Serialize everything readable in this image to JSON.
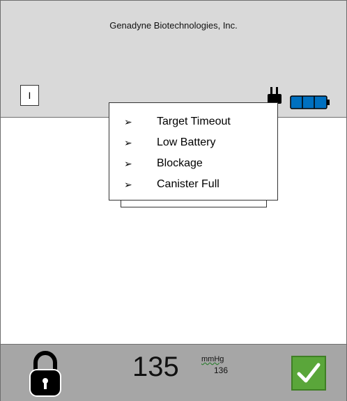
{
  "header": {
    "company": "Genadyne Biotechnologies, Inc.",
    "menu_label": "I",
    "power_icon": "plug-icon",
    "battery_icon": "battery-icon"
  },
  "alarm_list": {
    "items": [
      {
        "label": "Target Timeout"
      },
      {
        "label": "Low Battery"
      },
      {
        "label": "Blockage"
      },
      {
        "label": "Canister Full"
      }
    ],
    "bullet": "➢"
  },
  "footer": {
    "pressure_value": "135",
    "unit": "mmHg",
    "setpoint": "136",
    "lock_icon": "lock-icon",
    "confirm_icon": "checkmark-icon"
  },
  "colors": {
    "header_bg": "#d9d9d9",
    "footer_bg": "#a6a6a6",
    "battery_fill": "#0070c0",
    "confirm_bg": "#5aa63a"
  }
}
